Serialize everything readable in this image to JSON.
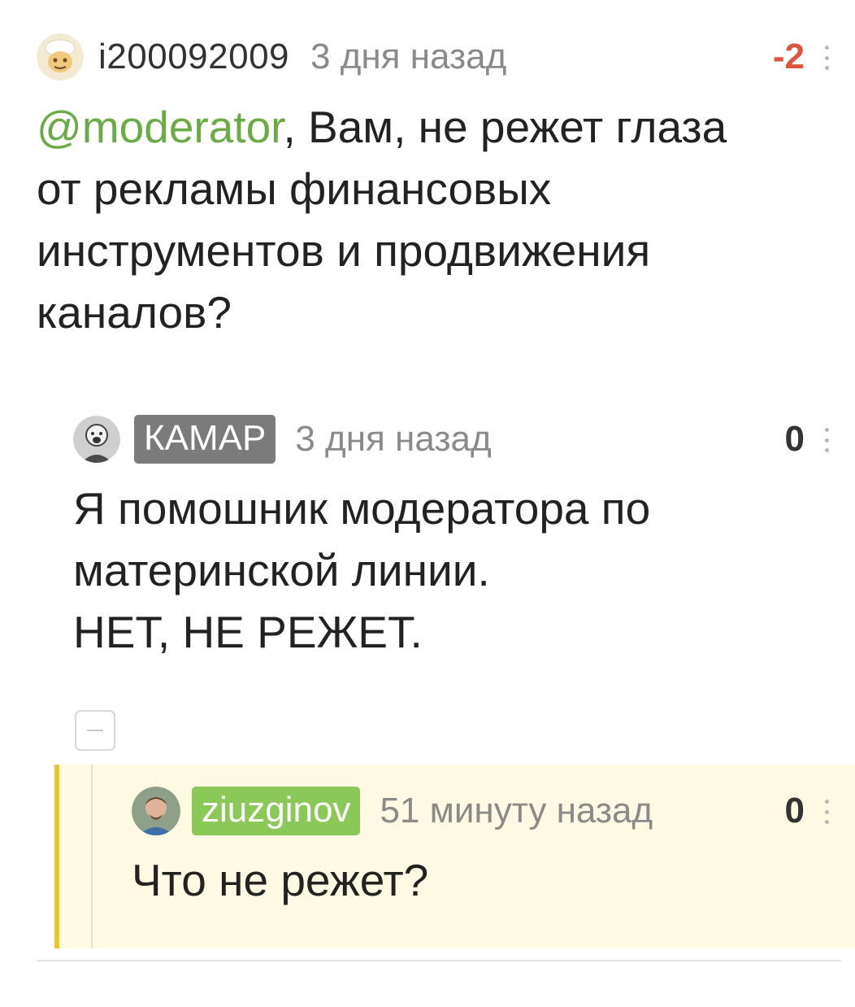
{
  "comments": [
    {
      "author": "i200092009",
      "time": "3 дня назад",
      "rating": "-2",
      "rating_color": "#e0533d",
      "mention": "@moderator",
      "text": ", Вам, не режет глаза\nот рекламы финансовых\nинструментов и продвижения\nканалов?"
    },
    {
      "author": "КАМАР",
      "time": "3 дня назад",
      "rating": "0",
      "text": "Я помошник модератора по\nматеринской линии.\nНЕТ, НЕ РЕЖЕТ."
    },
    {
      "author": "ziuzginov",
      "time": "51 минуту назад",
      "rating": "0",
      "text": "Что не режет?"
    }
  ],
  "icons": {
    "avatar_1": "cartoon-avatar-icon",
    "avatar_2": "photo-avatar-icon",
    "avatar_3": "photo-avatar-icon",
    "more": "vertical-dots-icon",
    "collapse": "minus-icon"
  },
  "colors": {
    "accent_green": "#8ac858",
    "mention_green": "#6aab45",
    "highlight_bg": "#fdf9e3",
    "highlight_bar": "#f2c22b",
    "negative_rating": "#e0533d"
  }
}
